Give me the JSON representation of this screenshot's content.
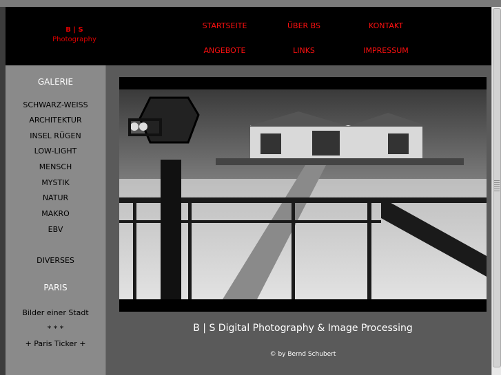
{
  "header": {
    "logo_mark": "B | S",
    "logo_text": "Photography",
    "nav": [
      "STARTSEITE",
      "ÜBER BS",
      "KONTAKT",
      "ANGEBOTE",
      "LINKS",
      "IMPRESSUM"
    ]
  },
  "sidebar": {
    "gallery_heading": "GALERIE",
    "gallery_items": [
      "SCHWARZ-WEISS",
      "ARCHITEKTUR",
      "INSEL RÜGEN",
      "LOW-LIGHT",
      "MENSCH",
      "MYSTIK",
      "NATUR",
      "MAKRO",
      "EBV"
    ],
    "diverses": "DIVERSES",
    "paris_heading": "PARIS",
    "paris_items": [
      "Bilder einer Stadt",
      "* * *",
      "+ Paris Ticker +"
    ]
  },
  "main": {
    "tagline": "B | S  Digital Photography & Image Processing",
    "copyright": "© by Bernd Schubert"
  },
  "colors": {
    "nav_red": "#ff1010",
    "header_bg": "#000000",
    "sidebar_bg": "#8a8a8a",
    "main_bg": "#5a5a5a"
  }
}
